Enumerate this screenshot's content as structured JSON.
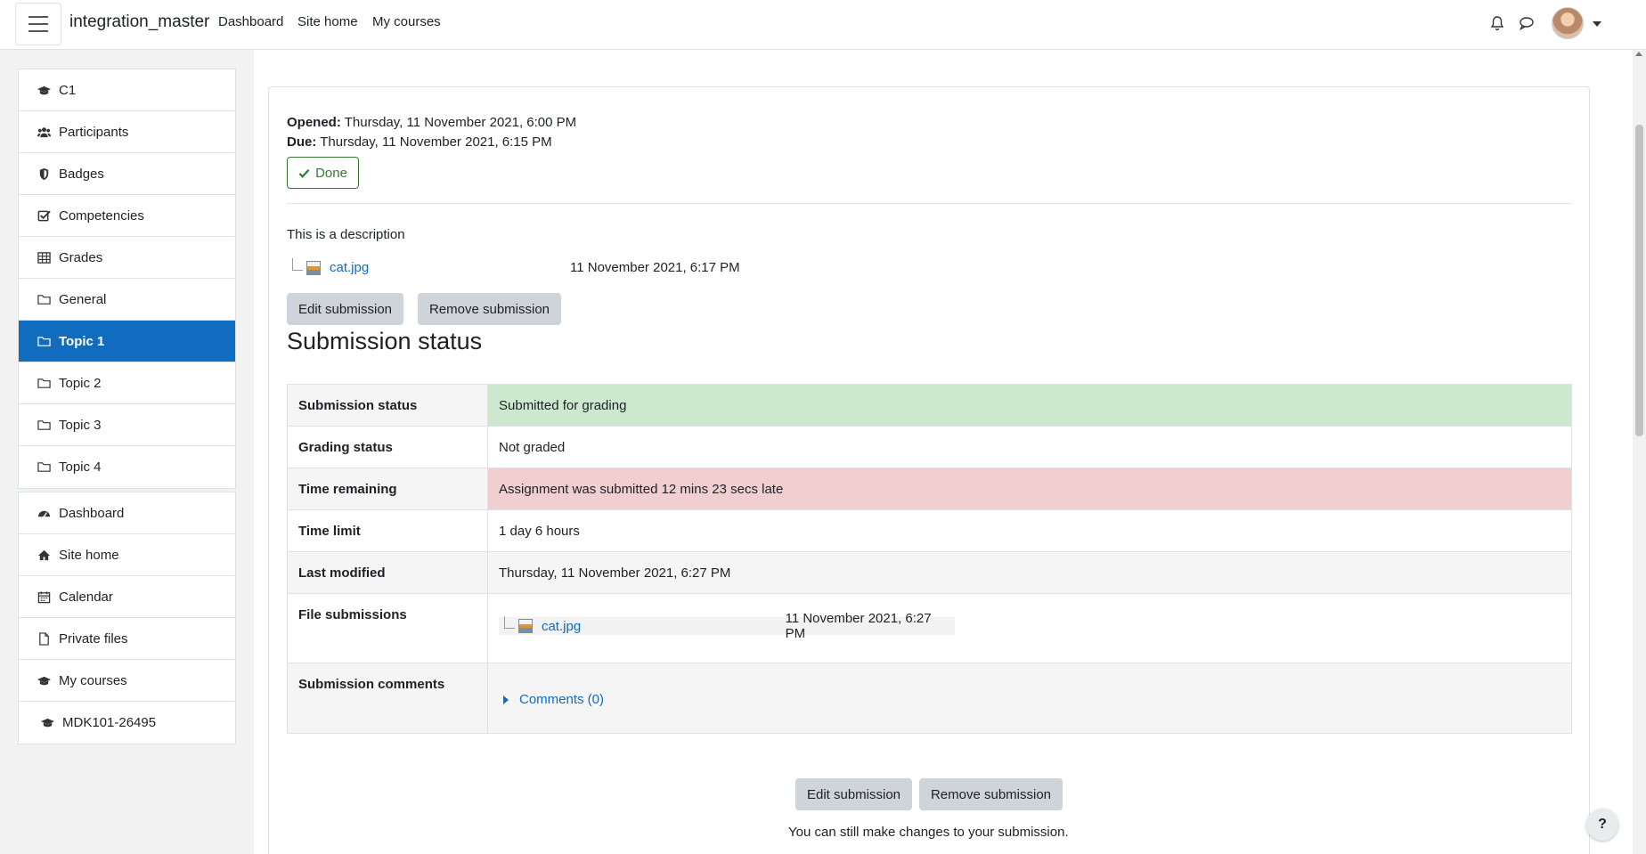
{
  "navbar": {
    "brand": "integration_master",
    "links": [
      "Dashboard",
      "Site home",
      "My courses"
    ],
    "icons": [
      "menu-icon",
      "bell-icon",
      "chat-icon",
      "user-avatar",
      "caret-down-icon"
    ]
  },
  "drawer": {
    "course_items": [
      {
        "label": "C1",
        "icon": "graduation-cap-icon"
      },
      {
        "label": "Participants",
        "icon": "users-icon"
      },
      {
        "label": "Badges",
        "icon": "shield-icon"
      },
      {
        "label": "Competencies",
        "icon": "check-square-icon"
      },
      {
        "label": "Grades",
        "icon": "table-icon"
      },
      {
        "label": "General",
        "icon": "folder-icon"
      },
      {
        "label": "Topic 1",
        "icon": "folder-icon",
        "active": true
      },
      {
        "label": "Topic 2",
        "icon": "folder-icon"
      },
      {
        "label": "Topic 3",
        "icon": "folder-icon"
      },
      {
        "label": "Topic 4",
        "icon": "folder-icon"
      }
    ],
    "site_items": [
      {
        "label": "Dashboard",
        "icon": "tachometer-icon"
      },
      {
        "label": "Site home",
        "icon": "home-icon"
      },
      {
        "label": "Calendar",
        "icon": "calendar-icon"
      },
      {
        "label": "Private files",
        "icon": "file-icon"
      },
      {
        "label": "My courses",
        "icon": "graduation-cap-icon"
      },
      {
        "label": "MDK101-26495",
        "icon": "graduation-cap-icon"
      }
    ]
  },
  "assignment": {
    "opened_label": "Opened:",
    "opened_value": "Thursday, 11 November 2021, 6:00 PM",
    "due_label": "Due:",
    "due_value": "Thursday, 11 November 2021, 6:15 PM",
    "done_label": "Done",
    "description": "This is a description",
    "attachment": {
      "name": "cat.jpg",
      "date": "11 November 2021, 6:17 PM"
    },
    "edit_label": "Edit submission",
    "remove_label": "Remove submission",
    "section_title": "Submission status"
  },
  "status_table": {
    "rows": [
      {
        "key": "Submission status",
        "value": "Submitted for grading"
      },
      {
        "key": "Grading status",
        "value": "Not graded"
      },
      {
        "key": "Time remaining",
        "value": "Assignment was submitted 12 mins 23 secs late"
      },
      {
        "key": "Time limit",
        "value": "1 day 6 hours"
      },
      {
        "key": "Last modified",
        "value": "Thursday, 11 November 2021, 6:27 PM"
      },
      {
        "key": "File submissions",
        "file_name": "cat.jpg",
        "file_date": "11 November 2021, 6:27 PM"
      },
      {
        "key": "Submission comments",
        "value": "Comments (0)"
      }
    ],
    "colors": {
      "success": "#cce9d0",
      "danger": "#f1cfd0"
    }
  },
  "footer": {
    "edit_label": "Edit submission",
    "remove_label": "Remove submission",
    "note": "You can still make changes to your submission.",
    "help": "?"
  },
  "colors": {
    "primary": "#0f6cbf",
    "done_green": "#357a32"
  }
}
